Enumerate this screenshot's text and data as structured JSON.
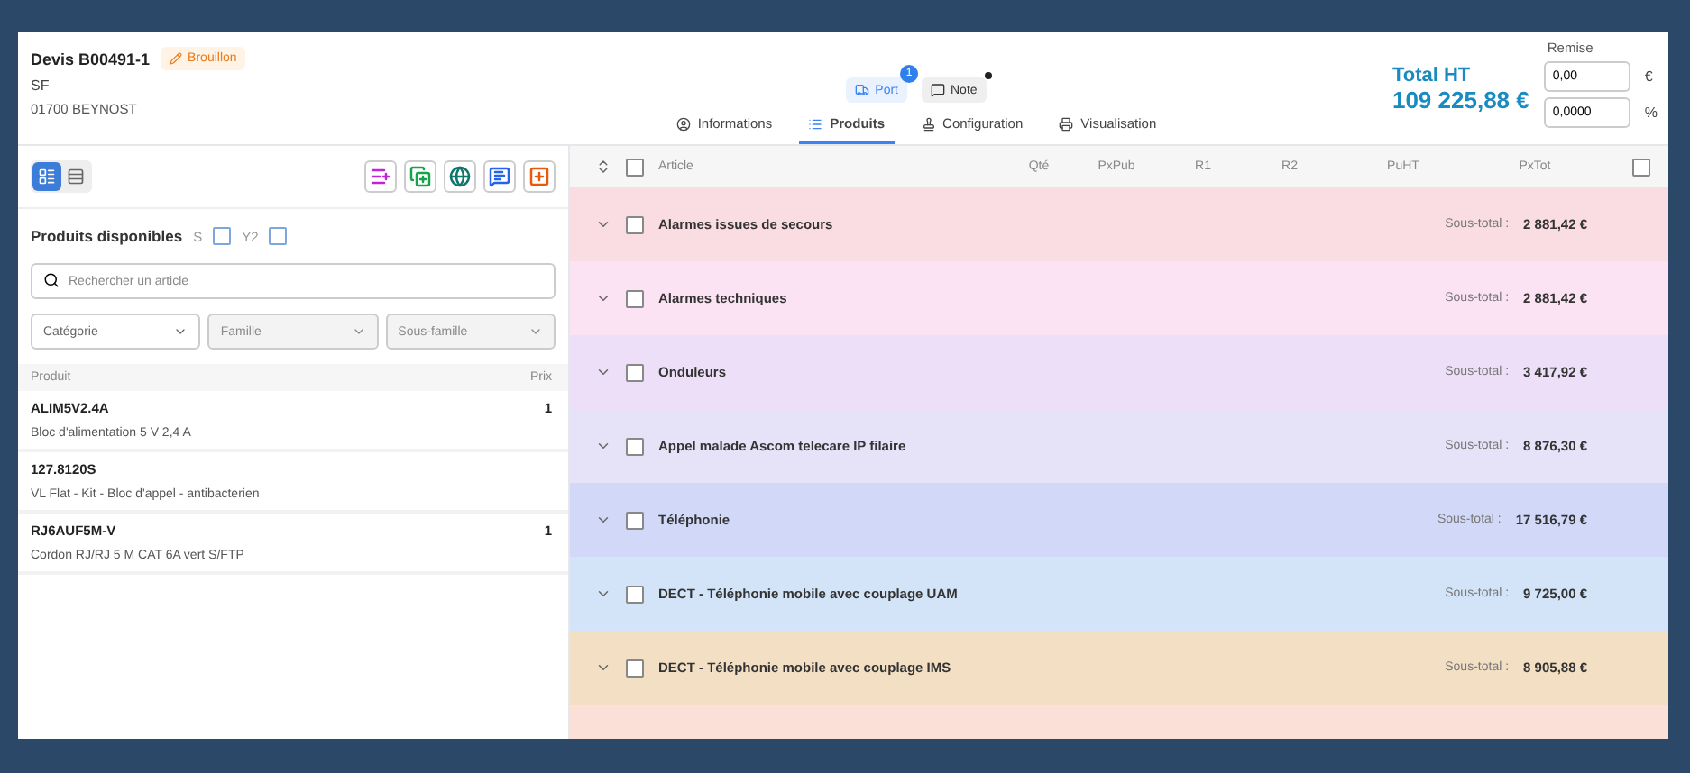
{
  "quote": {
    "title": "Devis B00491-1",
    "status": "Brouillon",
    "client": "SF",
    "address": "01700 BEYNOST"
  },
  "actions": [
    {
      "kind": "port",
      "label": "Port",
      "badge": "1"
    },
    {
      "kind": "note",
      "label": "Note",
      "dot": true
    }
  ],
  "tabs": [
    {
      "kind": "info",
      "label": "Informations",
      "selected": false
    },
    {
      "kind": "list",
      "label": "Produits",
      "selected": true
    },
    {
      "kind": "config",
      "label": "Configuration",
      "selected": false
    },
    {
      "kind": "print",
      "label": "Visualisation",
      "selected": false
    }
  ],
  "total": {
    "label": "Total HT",
    "value": "109 225,88 €"
  },
  "discount": {
    "label": "Remise",
    "fields": [
      {
        "value": "0,00",
        "unit": "€"
      },
      {
        "value": "0,0000",
        "unit": "%"
      }
    ]
  },
  "view_toggle": [
    {
      "kind": "cards",
      "selected": true
    },
    {
      "kind": "list",
      "selected": false
    }
  ],
  "tools": [
    {
      "kind": "add-lines",
      "color": "#c026d3"
    },
    {
      "kind": "copy",
      "color": "#16a34a"
    },
    {
      "kind": "globe",
      "color": "#0f766e"
    },
    {
      "kind": "comment",
      "color": "#2563eb"
    },
    {
      "kind": "add-section",
      "color": "#ea580c"
    }
  ],
  "catalog": {
    "title": "Produits disponibles",
    "filters": [
      {
        "label": "S",
        "checked": false
      },
      {
        "label": "Y2",
        "checked": false
      }
    ],
    "search": {
      "placeholder": "Rechercher un article"
    },
    "selects": [
      {
        "placeholder": "Catégorie",
        "disabled": false
      },
      {
        "placeholder": "Famille",
        "disabled": true
      },
      {
        "placeholder": "Sous-famille",
        "disabled": true
      }
    ],
    "columns": [
      "Produit",
      "Prix"
    ],
    "products": [
      {
        "code": "ALIM5V2.4A",
        "description": "Bloc d'alimentation 5 V 2,4 A",
        "price": "1"
      },
      {
        "code": "127.8120S",
        "description": "VL Flat - Kit - Bloc d'appel - antibacterien"
      },
      {
        "code": "RJ6AUF5M-V",
        "description": "Cordon RJ/RJ 5 M CAT 6A vert S/FTP",
        "price": "1"
      }
    ]
  },
  "table": {
    "columns": [
      "Article",
      "Qté",
      "PxPub",
      "R1",
      "R2",
      "PuHT",
      "PxTot"
    ],
    "all_checked": false,
    "sections": [
      {
        "name": "Alarmes issues de secours",
        "subtotal_label": "Sous-total :",
        "subtotal": "2 881,42 €",
        "color": "#fadce3",
        "checked": false
      },
      {
        "name": "Alarmes techniques",
        "subtotal_label": "Sous-total :",
        "subtotal": "2 881,42 €",
        "color": "#fce3f4",
        "checked": false
      },
      {
        "name": "Onduleurs",
        "subtotal_label": "Sous-total :",
        "subtotal": "3 417,92 €",
        "color": "#eddff8",
        "checked": false
      },
      {
        "name": "Appel malade Ascom telecare IP filaire",
        "subtotal_label": "Sous-total :",
        "subtotal": "8 876,30 €",
        "color": "#e6e2f8",
        "checked": false
      },
      {
        "name": "Téléphonie",
        "subtotal_label": "Sous-total :",
        "subtotal": "17 516,79 €",
        "color": "#d2d9f8",
        "checked": false
      },
      {
        "name": "DECT - Téléphonie mobile avec couplage UAM",
        "subtotal_label": "Sous-total :",
        "subtotal": "9 725,00 €",
        "color": "#d3e4f8",
        "checked": false
      },
      {
        "name": "DECT - Téléphonie mobile avec couplage IMS",
        "subtotal_label": "Sous-total :",
        "subtotal": "8 905,88 €",
        "color": "#f3dfc3",
        "checked": false
      }
    ],
    "partial_row": {
      "color": "#fbe0d8"
    }
  }
}
